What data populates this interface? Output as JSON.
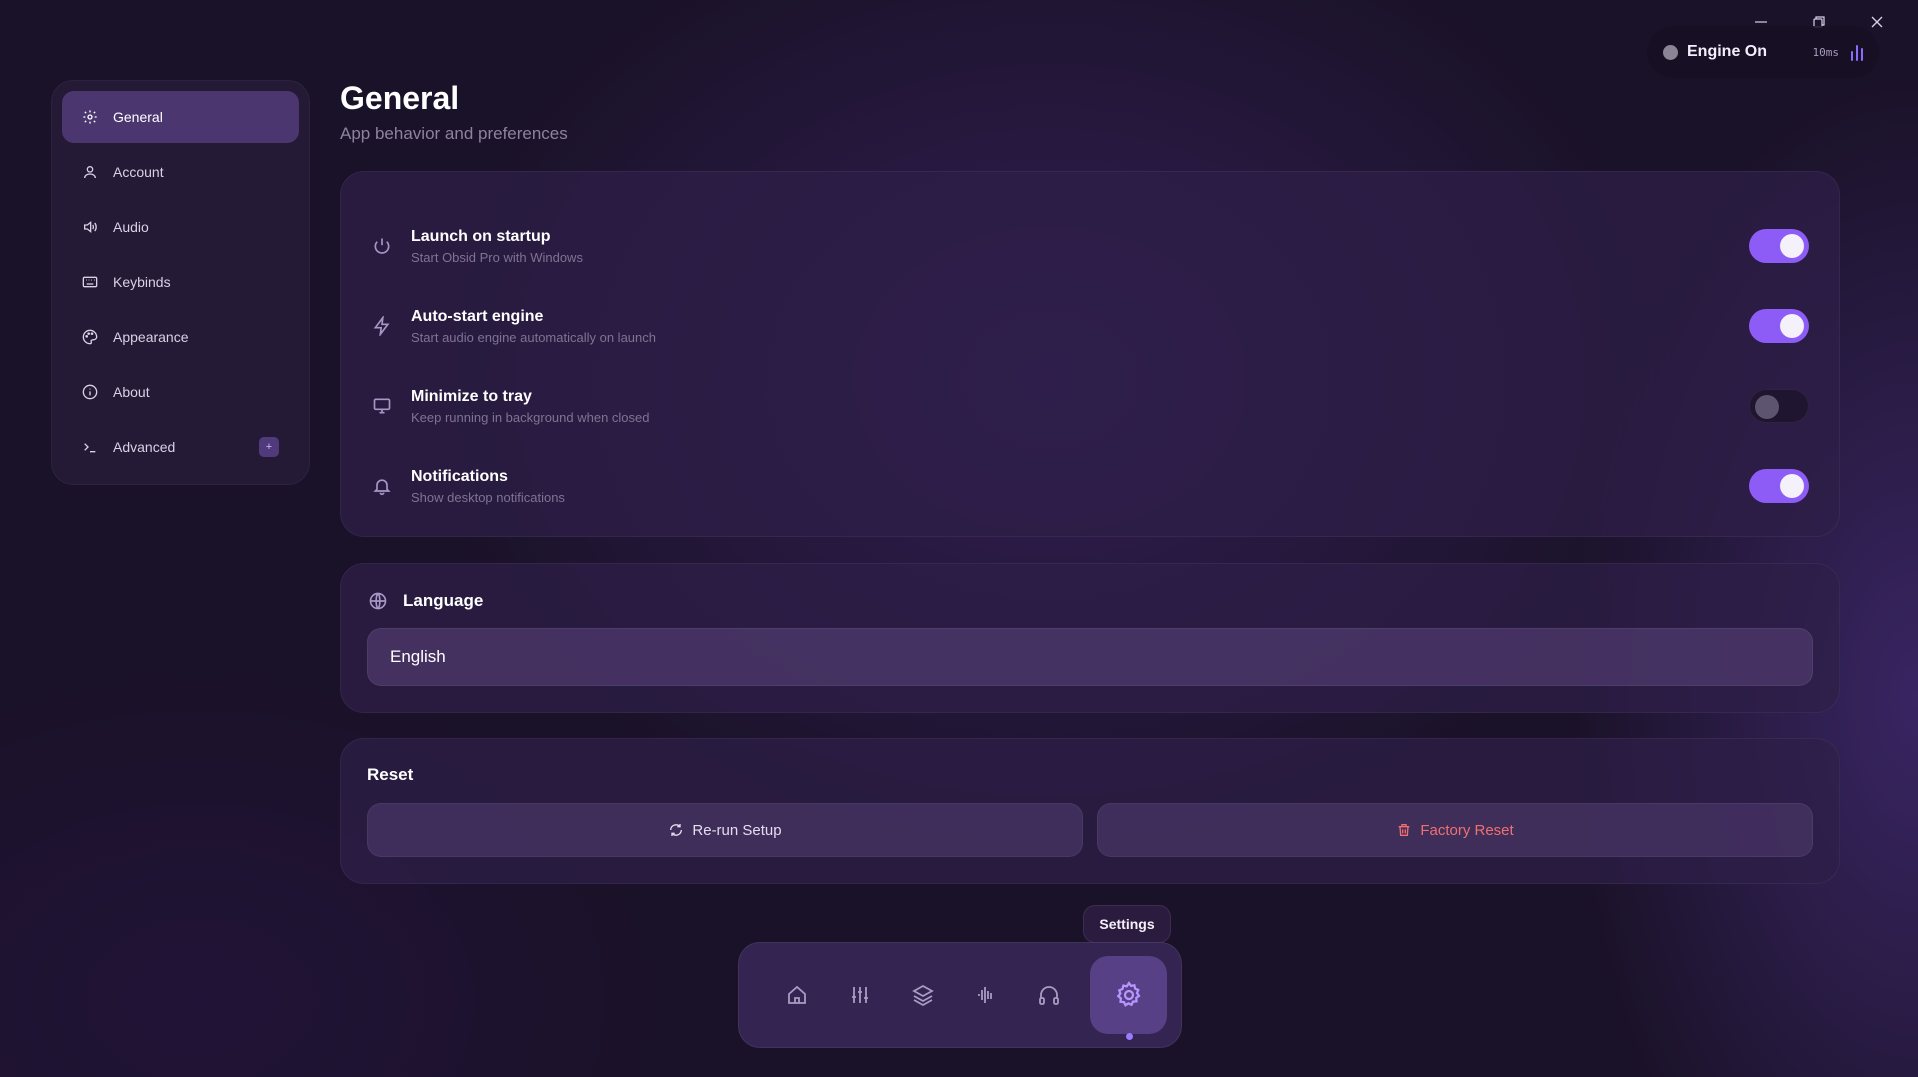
{
  "window": {
    "controls": [
      "minimize",
      "restore",
      "close"
    ]
  },
  "engine": {
    "status_label": "Engine On",
    "latency": "10ms",
    "status_color": "#8b8497",
    "accent": "#8b6cff"
  },
  "sidebar": {
    "items": [
      {
        "label": "General",
        "icon": "gear-icon",
        "active": true
      },
      {
        "label": "Account",
        "icon": "user-icon"
      },
      {
        "label": "Audio",
        "icon": "speaker-icon"
      },
      {
        "label": "Keybinds",
        "icon": "keyboard-icon"
      },
      {
        "label": "Appearance",
        "icon": "palette-icon"
      },
      {
        "label": "About",
        "icon": "info-icon"
      },
      {
        "label": "Advanced",
        "icon": "terminal-icon",
        "badge": "+"
      }
    ]
  },
  "page": {
    "title": "General",
    "subtitle": "App behavior and preferences"
  },
  "settings": [
    {
      "title": "Launch on startup",
      "desc": "Start Obsid Pro with Windows",
      "icon": "power-icon",
      "enabled": true
    },
    {
      "title": "Auto-start engine",
      "desc": "Start audio engine automatically on launch",
      "icon": "lightning-icon",
      "enabled": true
    },
    {
      "title": "Minimize to tray",
      "desc": "Keep running in background when closed",
      "icon": "monitor-icon",
      "enabled": false
    },
    {
      "title": "Notifications",
      "desc": "Show desktop notifications",
      "icon": "bell-icon",
      "enabled": true
    }
  ],
  "language": {
    "heading": "Language",
    "icon": "globe-icon",
    "selected": "English"
  },
  "reset": {
    "heading": "Reset",
    "rerun_label": "Re-run Setup",
    "factory_label": "Factory Reset",
    "danger_color": "#f07070"
  },
  "dock": {
    "tooltip": "Settings",
    "items": [
      "home-icon",
      "sliders-icon",
      "layers-icon",
      "waveform-icon",
      "headphones-icon",
      "gear-icon"
    ],
    "active_index": 5
  },
  "colors": {
    "toggle_on": "#8d5cf6",
    "background": "#1a1228"
  }
}
